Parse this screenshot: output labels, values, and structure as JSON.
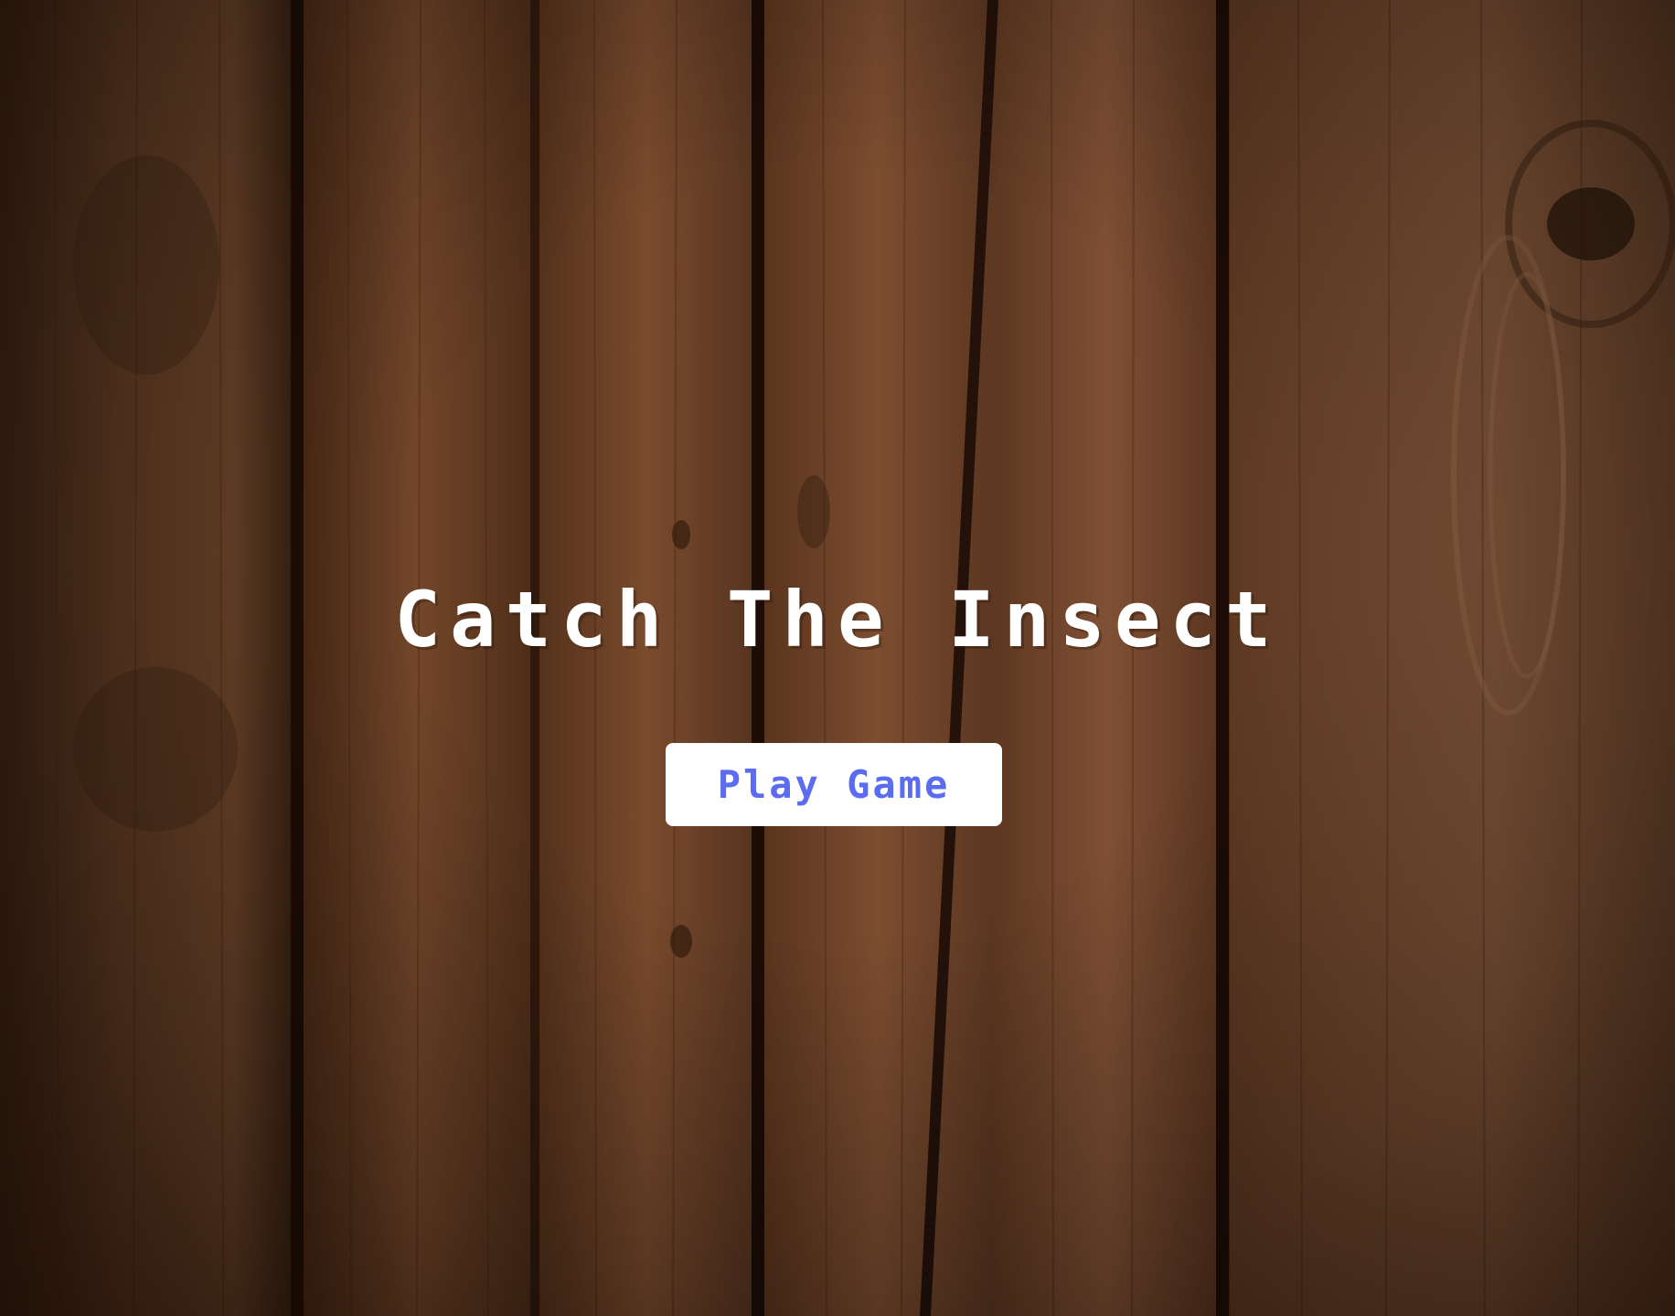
{
  "screen": {
    "title": "Catch The Insect",
    "play_button_label": "Play Game"
  },
  "colors": {
    "title_text": "#ffffff",
    "button_background": "#ffffff",
    "button_text": "#5b6cf0",
    "wood_base": "#5a341c"
  },
  "background": {
    "description_icon": "wood-planks-background"
  }
}
